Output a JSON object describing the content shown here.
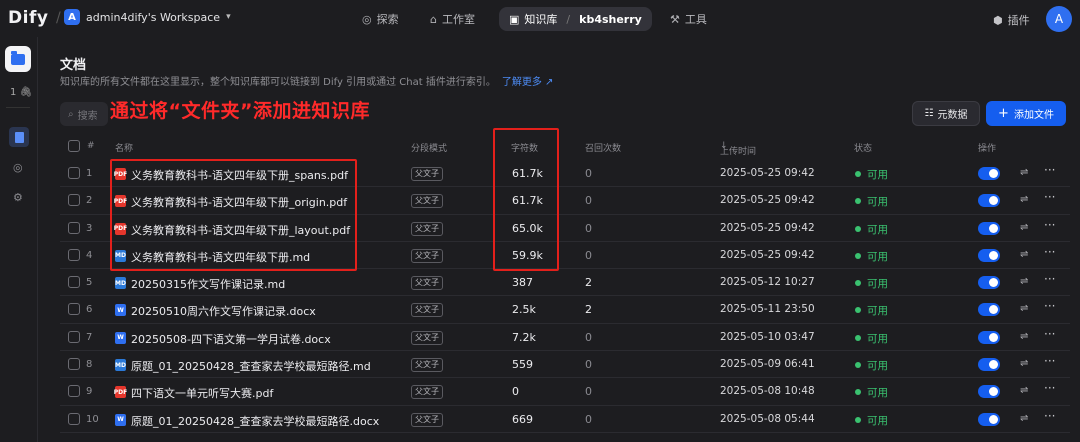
{
  "app": {
    "logo": "Dify",
    "workspace_badge": "A",
    "workspace": "admin4dify's Workspace"
  },
  "nav": {
    "explore": "探索",
    "studio": "工作室",
    "knowledge": "知识库",
    "kb_name": "kb4sherry",
    "tools": "工具",
    "plugins": "插件",
    "avatar": "A"
  },
  "rail": {
    "count": "1"
  },
  "page": {
    "title": "文档",
    "description": "知识库的所有文件都在这里显示，整个知识库都可以链接到 Dify 引用或通过 Chat 插件进行索引。",
    "learn_more": "了解更多",
    "search_placeholder": "搜索",
    "annotation": "通过将“文件夹”添加进知识库",
    "metadata_button": "元数据",
    "add_file_button": "添加文件"
  },
  "table": {
    "headers": {
      "idx": "#",
      "name": "名称",
      "mode": "分段模式",
      "chars": "字符数",
      "recall": "召回次数",
      "upload": "上传时间",
      "status": "状态",
      "action": "操作"
    },
    "rows": [
      {
        "idx": "1",
        "type": "pdf",
        "name": "义务教育教科书-语文四年级下册_spans.pdf",
        "mode": "父文子",
        "chars": "61.7k",
        "recall": "0",
        "upload": "2025-05-25 09:42",
        "status": "可用"
      },
      {
        "idx": "2",
        "type": "pdf",
        "name": "义务教育教科书-语文四年级下册_origin.pdf",
        "mode": "父文子",
        "chars": "61.7k",
        "recall": "0",
        "upload": "2025-05-25 09:42",
        "status": "可用"
      },
      {
        "idx": "3",
        "type": "pdf",
        "name": "义务教育教科书-语文四年级下册_layout.pdf",
        "mode": "父文子",
        "chars": "65.0k",
        "recall": "0",
        "upload": "2025-05-25 09:42",
        "status": "可用"
      },
      {
        "idx": "4",
        "type": "md",
        "name": "义务教育教科书-语文四年级下册.md",
        "mode": "父文子",
        "chars": "59.9k",
        "recall": "0",
        "upload": "2025-05-25 09:42",
        "status": "可用"
      },
      {
        "idx": "5",
        "type": "md",
        "name": "20250315作文写作课记录.md",
        "mode": "父文子",
        "chars": "387",
        "recall": "2",
        "upload": "2025-05-12 10:27",
        "status": "可用"
      },
      {
        "idx": "6",
        "type": "docx",
        "name": "20250510周六作文写作课记录.docx",
        "mode": "父文子",
        "chars": "2.5k",
        "recall": "2",
        "upload": "2025-05-11 23:50",
        "status": "可用"
      },
      {
        "idx": "7",
        "type": "docx",
        "name": "20250508-四下语文第一学月试卷.docx",
        "mode": "父文子",
        "chars": "7.2k",
        "recall": "0",
        "upload": "2025-05-10 03:47",
        "status": "可用"
      },
      {
        "idx": "8",
        "type": "md",
        "name": "原题_01_20250428_查查家去学校最短路径.md",
        "mode": "父文子",
        "chars": "559",
        "recall": "0",
        "upload": "2025-05-09 06:41",
        "status": "可用"
      },
      {
        "idx": "9",
        "type": "pdf",
        "name": "四下语文一单元听写大赛.pdf",
        "mode": "父文子",
        "chars": "0",
        "recall": "0",
        "upload": "2025-05-08 10:48",
        "status": "可用"
      },
      {
        "idx": "10",
        "type": "docx",
        "name": "原题_01_20250428_查查家去学校最短路径.docx",
        "mode": "父文子",
        "chars": "669",
        "recall": "0",
        "upload": "2025-05-08 05:44",
        "status": "可用"
      }
    ]
  },
  "colors": {
    "accent": "#155eef",
    "status_ok": "#3ac270",
    "highlight": "#e3201b"
  }
}
